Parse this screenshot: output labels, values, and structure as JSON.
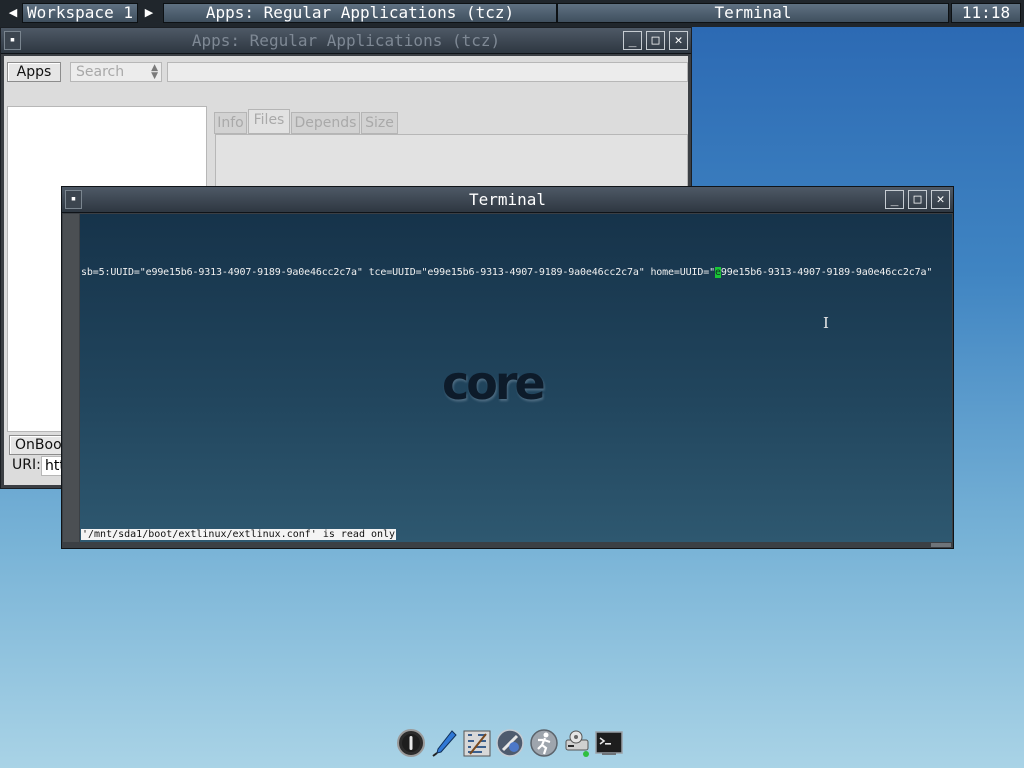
{
  "taskbar": {
    "workspace": "Workspace 1",
    "tasks": [
      "Apps: Regular Applications (tcz)",
      "Terminal"
    ],
    "clock": "11:18"
  },
  "apps_window": {
    "title": "Apps: Regular Applications (tcz)",
    "apps_button": "Apps",
    "search_value": "Search",
    "tabs": [
      "Info",
      "Files",
      "Depends",
      "Size"
    ],
    "onboot_button": "OnBoot",
    "uri_label": "URI:",
    "uri_value": "htt"
  },
  "terminal": {
    "title": "Terminal",
    "line_prefix": "sb=5:UUID=\"e99e15b6-9313-4907-9189-9a0e46cc2c7a\" tce=UUID=\"e99e15b6-9313-4907-9189-9a0e46cc2c7a\" home=UUID=\"",
    "cursor_char": "e",
    "line_suffix": "99e15b6-9313-4907-9189-9a0e46cc2c7a\"",
    "status": "'/mnt/sda1/boot/extlinux/extlinux.conf' is read only",
    "wallpaper_logo": "core"
  },
  "dock": {
    "icons": [
      "power-icon",
      "editor-icon",
      "control-panel-icon",
      "apps-icon",
      "run-icon",
      "mount-tool-icon",
      "terminal-icon"
    ]
  }
}
